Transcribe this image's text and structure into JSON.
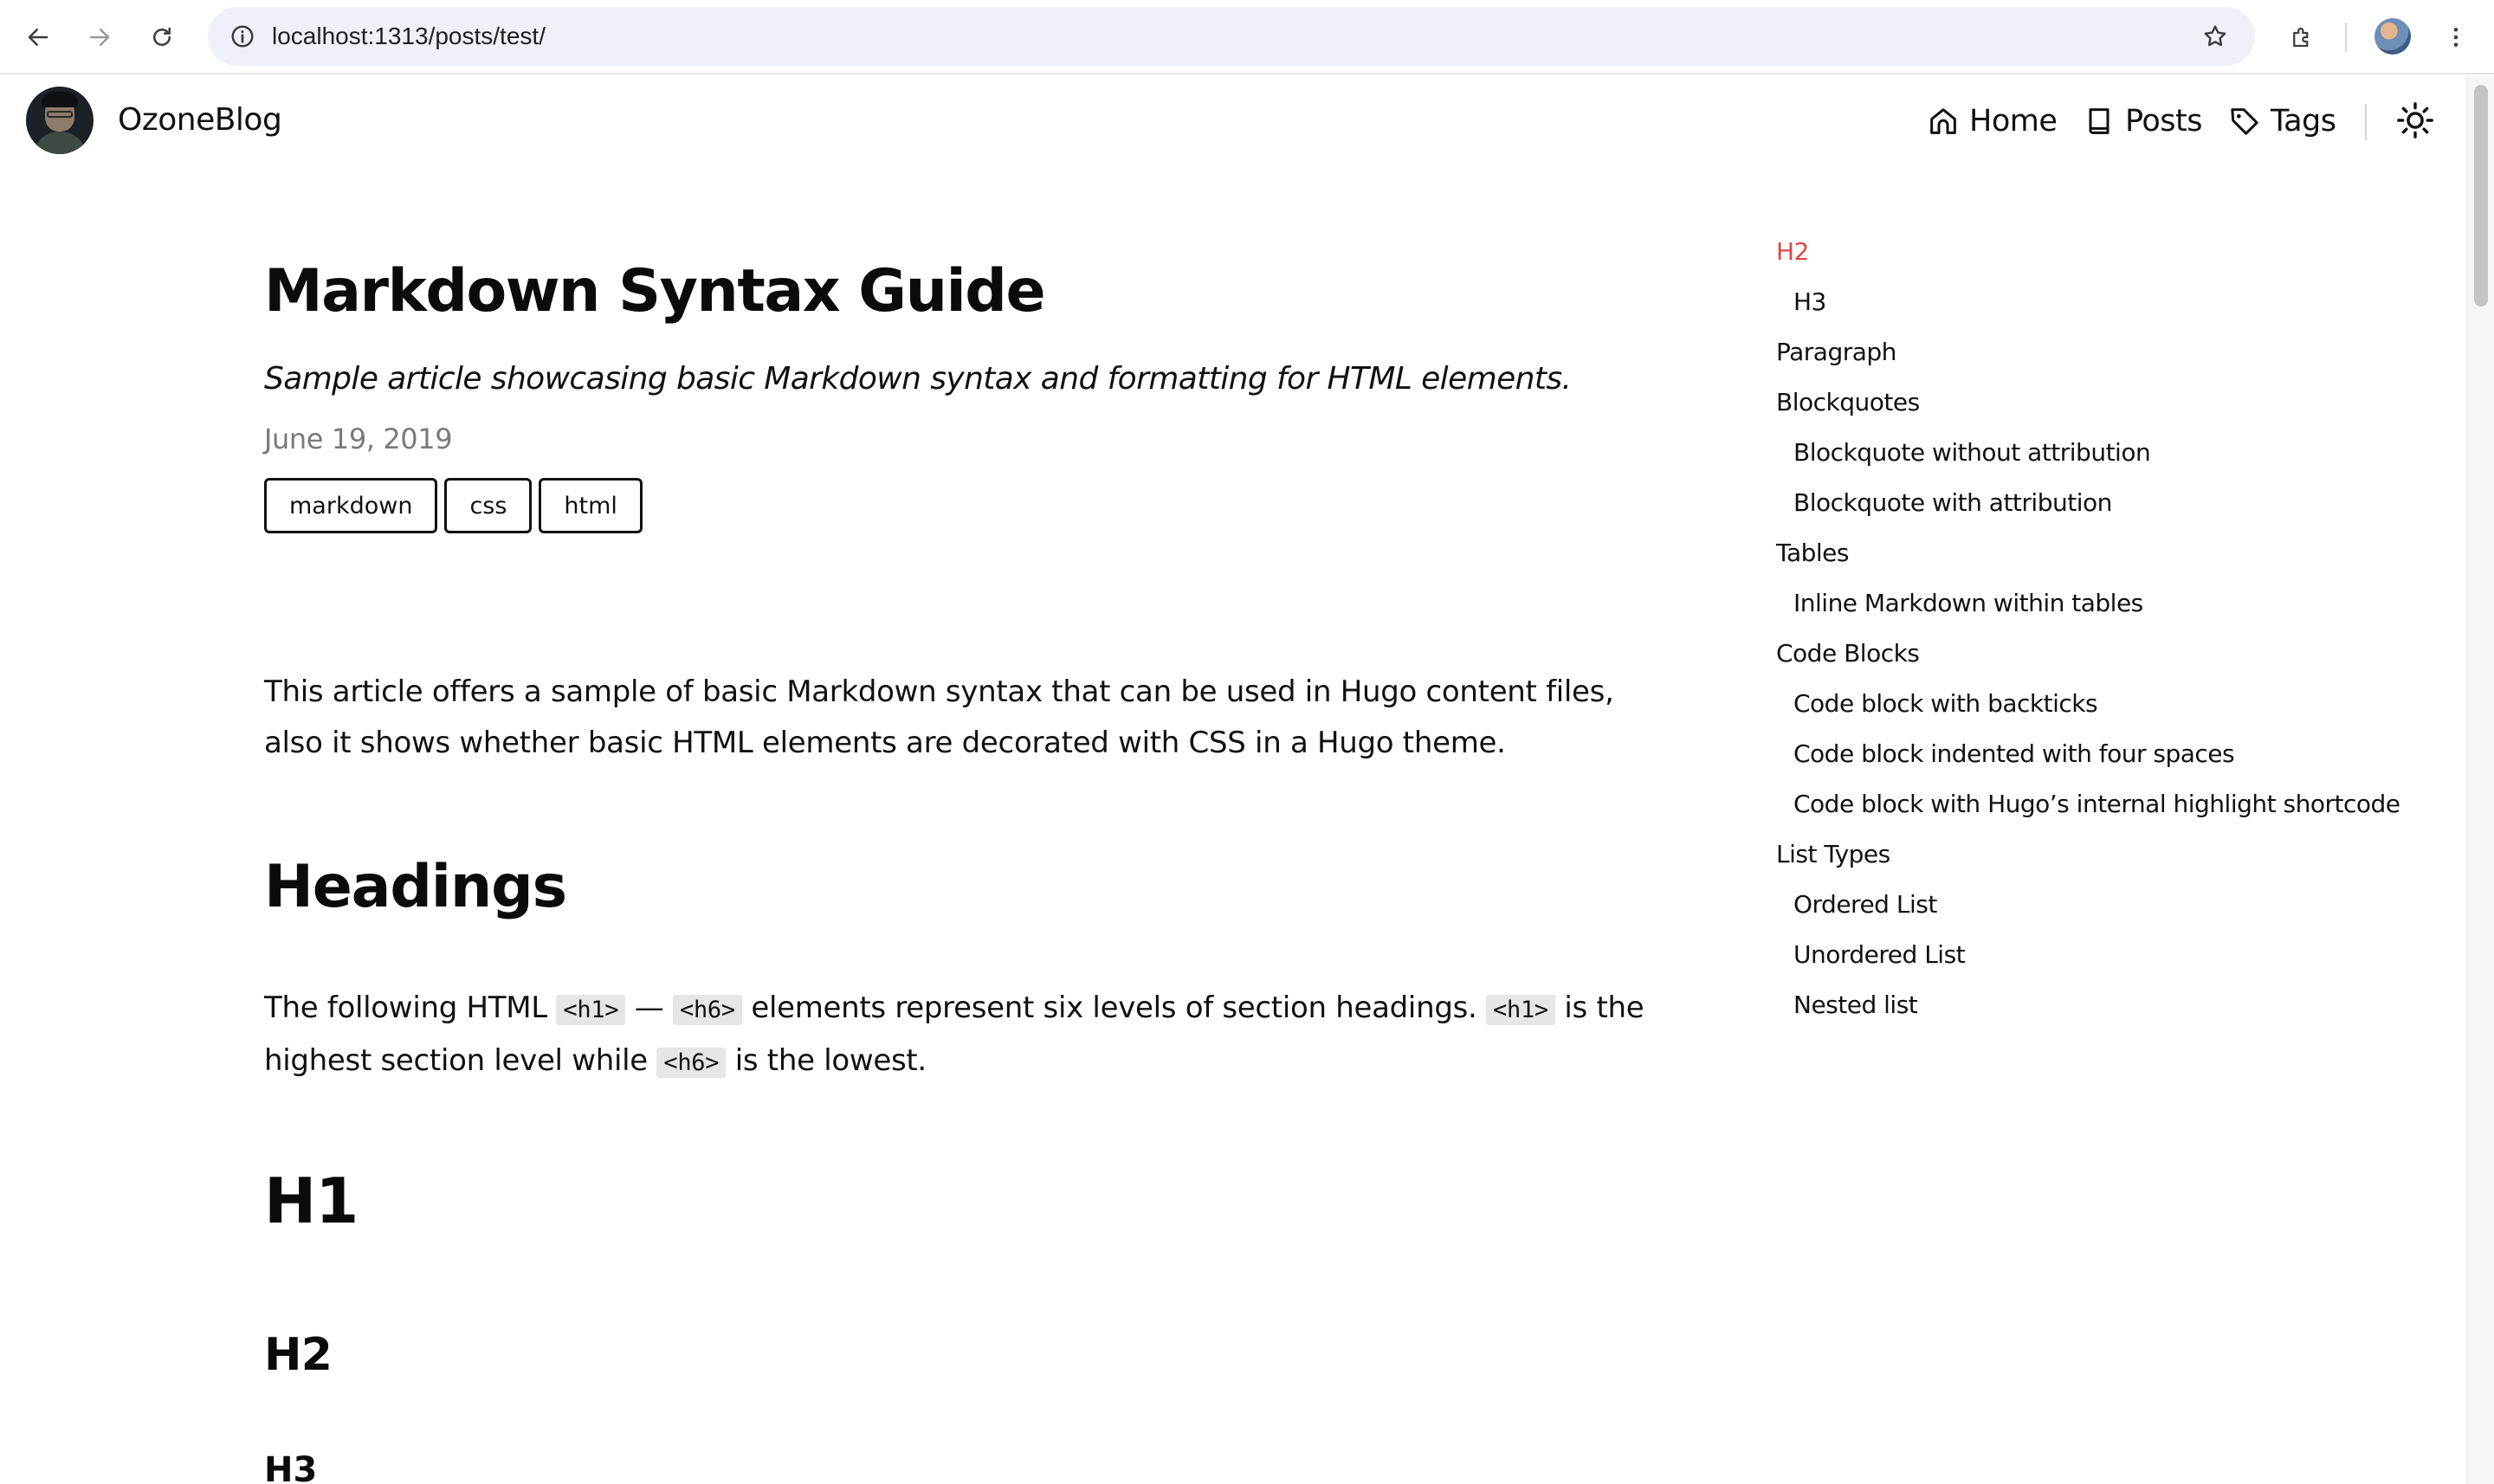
{
  "browser": {
    "url": "localhost:1313/posts/test/"
  },
  "header": {
    "site_title": "OzoneBlog",
    "nav": [
      {
        "label": "Home",
        "icon": "home-icon"
      },
      {
        "label": "Posts",
        "icon": "book-icon"
      },
      {
        "label": "Tags",
        "icon": "tag-icon"
      }
    ],
    "theme_toggle_icon": "sun-icon"
  },
  "article": {
    "title": "Markdown Syntax Guide",
    "description": "Sample article showcasing basic Markdown syntax and formatting for HTML elements.",
    "date": "June 19, 2019",
    "tags": [
      "markdown",
      "css",
      "html"
    ],
    "intro": "This article offers a sample of basic Markdown syntax that can be used in Hugo content files, also it shows whether basic HTML elements are decorated with CSS in a Hugo theme.",
    "headings_title": "Headings",
    "headings_text": {
      "part1": "The following HTML ",
      "code1": "<h1>",
      "dash": "—",
      "code2": "<h6>",
      "part2": " elements represent six levels of section headings. ",
      "code3": "<h1>",
      "part3": " is the highest section level while ",
      "code4": "<h6>",
      "part4": " is the lowest."
    },
    "demo_h1": "H1",
    "demo_h2": "H2",
    "demo_h3": "H3"
  },
  "toc": {
    "active_color": "#e04545",
    "items": [
      {
        "label": "H2",
        "level": 1,
        "active": true
      },
      {
        "label": "H3",
        "level": 2
      },
      {
        "label": "Paragraph",
        "level": 1
      },
      {
        "label": "Blockquotes",
        "level": 1
      },
      {
        "label": "Blockquote without attribution",
        "level": 2
      },
      {
        "label": "Blockquote with attribution",
        "level": 2
      },
      {
        "label": "Tables",
        "level": 1
      },
      {
        "label": "Inline Markdown within tables",
        "level": 2
      },
      {
        "label": "Code Blocks",
        "level": 1
      },
      {
        "label": "Code block with backticks",
        "level": 2
      },
      {
        "label": "Code block indented with four spaces",
        "level": 2
      },
      {
        "label": "Code block with Hugo’s internal highlight shortcode",
        "level": 2
      },
      {
        "label": "List Types",
        "level": 1
      },
      {
        "label": "Ordered List",
        "level": 2
      },
      {
        "label": "Unordered List",
        "level": 2
      },
      {
        "label": "Nested list",
        "level": 2
      }
    ]
  }
}
